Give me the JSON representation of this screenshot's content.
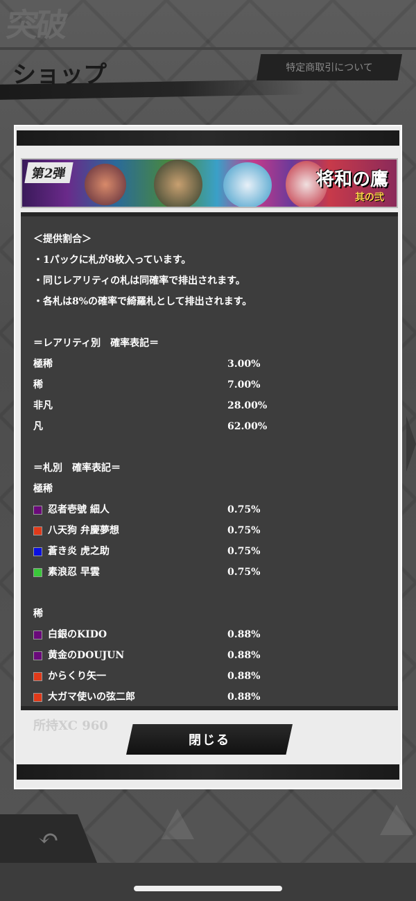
{
  "app": {
    "logo_text": "突破",
    "page_title": "ショップ",
    "legal_link": "特定商取引について"
  },
  "banner": {
    "left_label": "第2弾",
    "right_title": "将和の鷹",
    "right_sub": "其の弐"
  },
  "rates": {
    "heading": "＜提供割合＞",
    "notes": [
      "・1パックに札が8枚入っています。",
      "・同じレアリティの札は同確率で排出されます。",
      "・各札は8%の確率で綺羅札として排出されます。"
    ],
    "rarity_heading": "＝レアリティ別　確率表記＝",
    "rarity": [
      {
        "name": "極稀",
        "pct": "3.00%"
      },
      {
        "name": "稀",
        "pct": "7.00%"
      },
      {
        "name": "非凡",
        "pct": "28.00%"
      },
      {
        "name": "凡",
        "pct": "62.00%"
      }
    ],
    "card_heading": "＝札別　確率表記＝",
    "groups": [
      {
        "label": "極稀",
        "cards": [
          {
            "name": "忍者壱號 細人",
            "pct": "0.75%",
            "color": "#6a0a7a"
          },
          {
            "name": "八天狗 弁慶夢想",
            "pct": "0.75%",
            "color": "#e03a1a"
          },
          {
            "name": "蒼き炎 虎之助",
            "pct": "0.75%",
            "color": "#0a10e0"
          },
          {
            "name": "素浪忍 早雲",
            "pct": "0.75%",
            "color": "#3ac83a"
          }
        ]
      },
      {
        "label": "稀",
        "cards": [
          {
            "name": "白銀のKIDO",
            "pct": "0.88%",
            "color": "#6a0a7a"
          },
          {
            "name": "黄金のDOUJUN",
            "pct": "0.88%",
            "color": "#6a0a7a"
          },
          {
            "name": "からくり矢一",
            "pct": "0.88%",
            "color": "#e03a1a"
          },
          {
            "name": "大ガマ使いの弦二郎",
            "pct": "0.88%",
            "color": "#e03a1a"
          }
        ]
      }
    ]
  },
  "footer": {
    "coins_text": "所持XC 960",
    "close_label": "閉じる"
  }
}
